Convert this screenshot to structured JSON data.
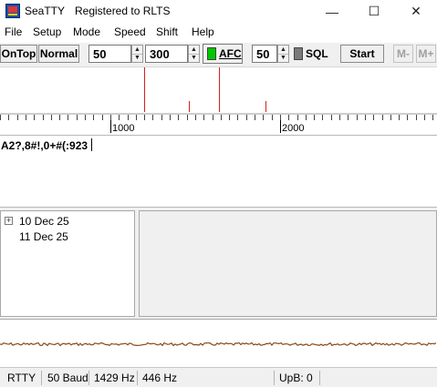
{
  "window": {
    "app_name": "SeaTTY",
    "registration": "Registered to RLTS",
    "min_glyph": "—",
    "max_glyph": "☐",
    "close_glyph": "✕"
  },
  "menu": [
    "File",
    "Setup",
    "Mode",
    "Speed",
    "Shift",
    "Help"
  ],
  "toolbar": {
    "ontop_label": "OnTop",
    "normal_label": "Normal",
    "baud_value": "50",
    "shift_value": "300",
    "afc_label": "AFC",
    "sql_level": "50",
    "sql_label": "SQL",
    "start_label": "Start",
    "mem_minus_label": "M-",
    "mem_plus_label": "M+",
    "spin_up_glyph": "▲",
    "spin_down_glyph": "▼"
  },
  "spectrum": {
    "ruler_labels": [
      "1000",
      "2000"
    ]
  },
  "rx_text": "A2?,8#!,0+#(:923",
  "log_tree": {
    "expander_glyph": "+",
    "items": [
      "10 Dec 25",
      "11 Dec 25"
    ]
  },
  "status": {
    "mode": "RTTY",
    "baud": "50 Baud",
    "mark_freq": "1429 Hz",
    "shift": "446 Hz",
    "upb": "UpB: 0"
  },
  "colors": {
    "afc_led": "#00c800",
    "sql_led": "#7a7a7a",
    "spectrum_line": "#d42020",
    "waterfall_trace": "#8a4a1a"
  }
}
